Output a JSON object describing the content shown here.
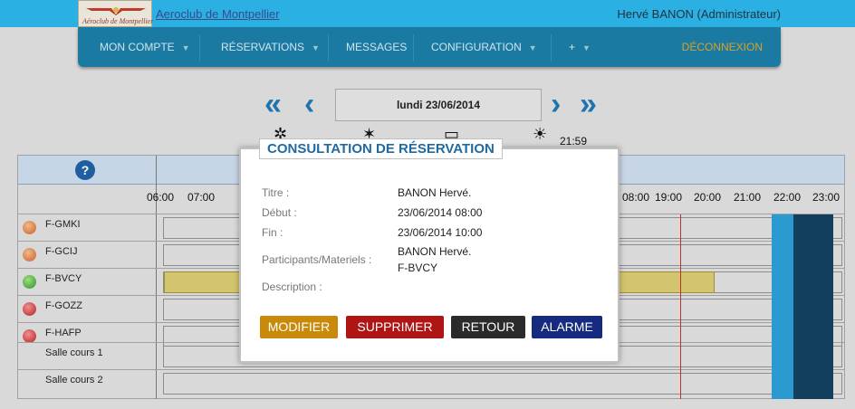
{
  "header": {
    "club_name": "Aeroclub de Montpellier",
    "logo_text": "Aéroclub de Montpellier",
    "user": "Hervé  BANON (Administrateur)"
  },
  "nav": {
    "items": [
      {
        "label": "MON COMPTE",
        "dropdown": true
      },
      {
        "label": "RÉSERVATIONS",
        "dropdown": true
      },
      {
        "label": "MESSAGES",
        "dropdown": false
      },
      {
        "label": "CONFIGURATION",
        "dropdown": true
      },
      {
        "label": "+",
        "dropdown": true
      }
    ],
    "logout": "DÉCONNEXION"
  },
  "date_nav": {
    "date": "lundi 23/06/2014",
    "current_time": "21:59"
  },
  "grid": {
    "hours": [
      "06:00",
      "07:00",
      "08:00",
      "19:00",
      "20:00",
      "21:00",
      "22:00",
      "23:00"
    ],
    "rows": [
      {
        "label": "F-GMKI",
        "status": "orange"
      },
      {
        "label": "F-GCIJ",
        "status": "orange"
      },
      {
        "label": "F-BVCY",
        "status": "green"
      },
      {
        "label": "F-GOZZ",
        "status": "red"
      },
      {
        "label": "F-HAFP",
        "status": "red"
      },
      {
        "label": "Salle cours 1",
        "status": "none"
      },
      {
        "label": "Salle cours 2",
        "status": "none"
      }
    ]
  },
  "modal": {
    "title": "CONSULTATION DE RÉSERVATION",
    "fields": {
      "titre_label": "Titre :",
      "titre": "BANON Hervé.",
      "debut_label": "Début :",
      "debut": "23/06/2014 08:00",
      "fin_label": "Fin :",
      "fin": "23/06/2014 10:00",
      "participants_label": "Participants/Materiels :",
      "participant_1": "BANON Hervé.",
      "participant_2": "F-BVCY",
      "description_label": "Description :"
    },
    "buttons": {
      "modifier": "MODIFIER",
      "supprimer": "SUPPRIMER",
      "retour": "RETOUR",
      "alarme": "ALARME"
    }
  },
  "colors": {
    "topbar": "#2ab0e2",
    "nav": "#1b7aa2",
    "accent": "#1f6aa0",
    "btn_modifier": "#c98a0c",
    "btn_supprimer": "#b01515",
    "btn_retour": "#2b2b2b",
    "btn_alarme": "#162a80"
  }
}
